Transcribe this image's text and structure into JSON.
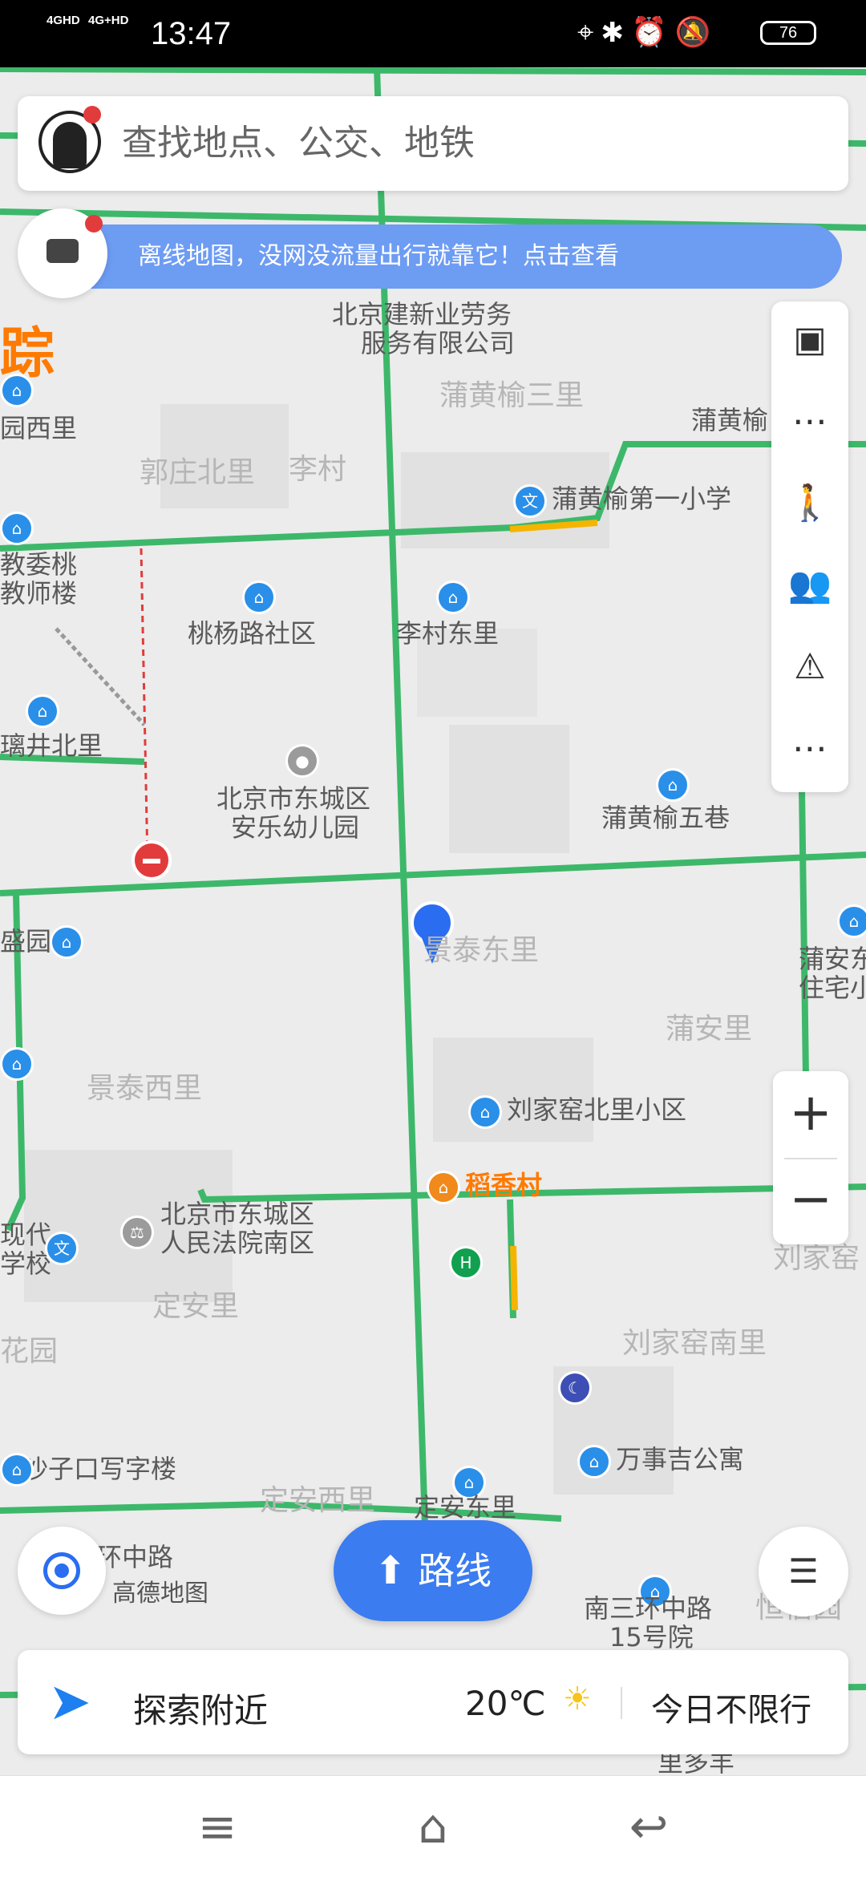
{
  "status_bar": {
    "signal_1": "4GHD",
    "signal_2": "4G+HD",
    "time": "13:47",
    "battery": "76"
  },
  "search": {
    "placeholder": "查找地点、公交、地铁"
  },
  "banner": {
    "text": "离线地图，没网没流量出行就靠它！点击查看"
  },
  "map_labels": [
    {
      "id": "l1",
      "text": "北京建新业劳务"
    },
    {
      "id": "l2",
      "text": "服务有限公司"
    },
    {
      "id": "l3",
      "text": "蒲黄榆三里"
    },
    {
      "id": "l4",
      "text": "蒲黄榆"
    },
    {
      "id": "l5",
      "text": "郭庄北里"
    },
    {
      "id": "l6",
      "text": "李村"
    },
    {
      "id": "l7",
      "text": "蒲黄榆第一小学"
    },
    {
      "id": "l8",
      "text": "桃杨路社区"
    },
    {
      "id": "l9",
      "text": "李村东里"
    },
    {
      "id": "l10",
      "text": "北京市东城区"
    },
    {
      "id": "l11",
      "text": "安乐幼儿园"
    },
    {
      "id": "l12",
      "text": "蒲黄榆五巷"
    },
    {
      "id": "l13",
      "text": "景泰东里"
    },
    {
      "id": "l14",
      "text": "蒲安里"
    },
    {
      "id": "l15",
      "text": "景泰西里"
    },
    {
      "id": "l16",
      "text": "刘家窑北里小区"
    },
    {
      "id": "l17",
      "text": "稻香村"
    },
    {
      "id": "l18",
      "text": "北京市东城区"
    },
    {
      "id": "l19",
      "text": "人民法院南区"
    },
    {
      "id": "l20",
      "text": "定安里"
    },
    {
      "id": "l21",
      "text": "刘家窑南里"
    },
    {
      "id": "l22",
      "text": "沙子口写字楼"
    },
    {
      "id": "l23",
      "text": "万事吉公寓"
    },
    {
      "id": "l24",
      "text": "定安西里"
    },
    {
      "id": "l25",
      "text": "定安东里"
    },
    {
      "id": "l26",
      "text": "南三环中路"
    },
    {
      "id": "l27",
      "text": "15号院"
    },
    {
      "id": "l28",
      "text": "园西里"
    },
    {
      "id": "l29",
      "text": "教委桃"
    },
    {
      "id": "l30",
      "text": "教师楼"
    },
    {
      "id": "l31",
      "text": "璃井北里"
    },
    {
      "id": "l32",
      "text": "盛园"
    },
    {
      "id": "l33",
      "text": "蒲安东"
    },
    {
      "id": "l34",
      "text": "住宅小"
    },
    {
      "id": "l35",
      "text": "刘家窑"
    },
    {
      "id": "l36",
      "text": "花园"
    },
    {
      "id": "l37",
      "text": "现代"
    },
    {
      "id": "l38",
      "text": "学校"
    },
    {
      "id": "l39",
      "text": "环中路"
    },
    {
      "id": "l40",
      "text": "恒信园"
    },
    {
      "id": "l41",
      "text": "里多羊"
    },
    {
      "id": "l42",
      "text": "踪"
    }
  ],
  "buttons": {
    "route": "路线",
    "zoom_in": "+",
    "zoom_out": "−"
  },
  "brand": "高德地图",
  "bottom": {
    "explore": "探索附近",
    "temperature": "20℃",
    "traffic_limit": "今日不限行"
  }
}
